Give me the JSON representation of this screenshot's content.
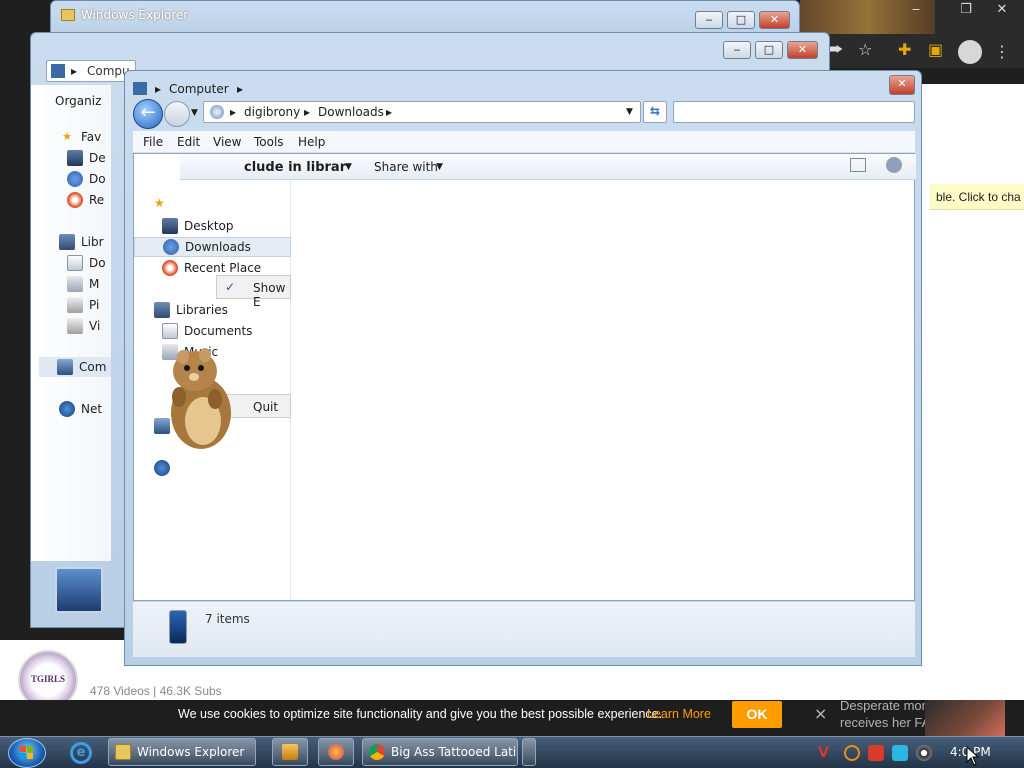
{
  "back_window": {
    "title": "Windows Explorer"
  },
  "mid_window": {
    "address_root": "Compu",
    "organize": "Organiz",
    "nav_favorites": "Fav",
    "nav_items": [
      "De",
      "Do",
      "Re"
    ],
    "nav_libraries": "Libr",
    "nav_lib_items": [
      "Do",
      "M",
      "Pi",
      "Vi"
    ],
    "nav_computer": "Com",
    "nav_network": "Net"
  },
  "front_window": {
    "breadcrumb_top": "Computer",
    "address_parts": [
      "digibrony",
      "Downloads"
    ],
    "menu": [
      "File",
      "Edit",
      "View",
      "Tools",
      "Help"
    ],
    "toolbar": {
      "include": "clude in librar",
      "share": "Share with"
    },
    "nav_items": [
      {
        "label": "Desktop",
        "icon": "desktop-icon"
      },
      {
        "label": "Downloads",
        "icon": "downloads-icon"
      },
      {
        "label": "Recent Place",
        "icon": "recent-places-icon"
      }
    ],
    "libraries_label": "Libraries",
    "lib_items": [
      {
        "label": "Documents",
        "icon": "documents-icon"
      },
      {
        "label": "Music",
        "icon": "music-icon"
      }
    ],
    "context_show": "Show E",
    "context_quit": "Quit",
    "status": "7 items"
  },
  "right_page": {
    "yellow_bar": "ble. Click to cha"
  },
  "channel": {
    "logo_text": "TGIRLS",
    "stats": "478 Videos | 46.3K Subs"
  },
  "cookie": {
    "text": "We use cookies to optimize site functionality and give you the best possible experience.",
    "learn_more": "Learn More",
    "ok": "OK",
    "close": "×"
  },
  "ad": {
    "line1": "Desperate mom",
    "line2": "receives her FAR"
  },
  "taskbar": {
    "explorer_label": "Windows Explorer",
    "chrome_label": "Big Ass Tattooed Lati...",
    "clock": "4:0 PM"
  },
  "colors": {
    "accent": "#ff9d00",
    "taskbar": "#233447",
    "close_red": "#c2412a"
  }
}
